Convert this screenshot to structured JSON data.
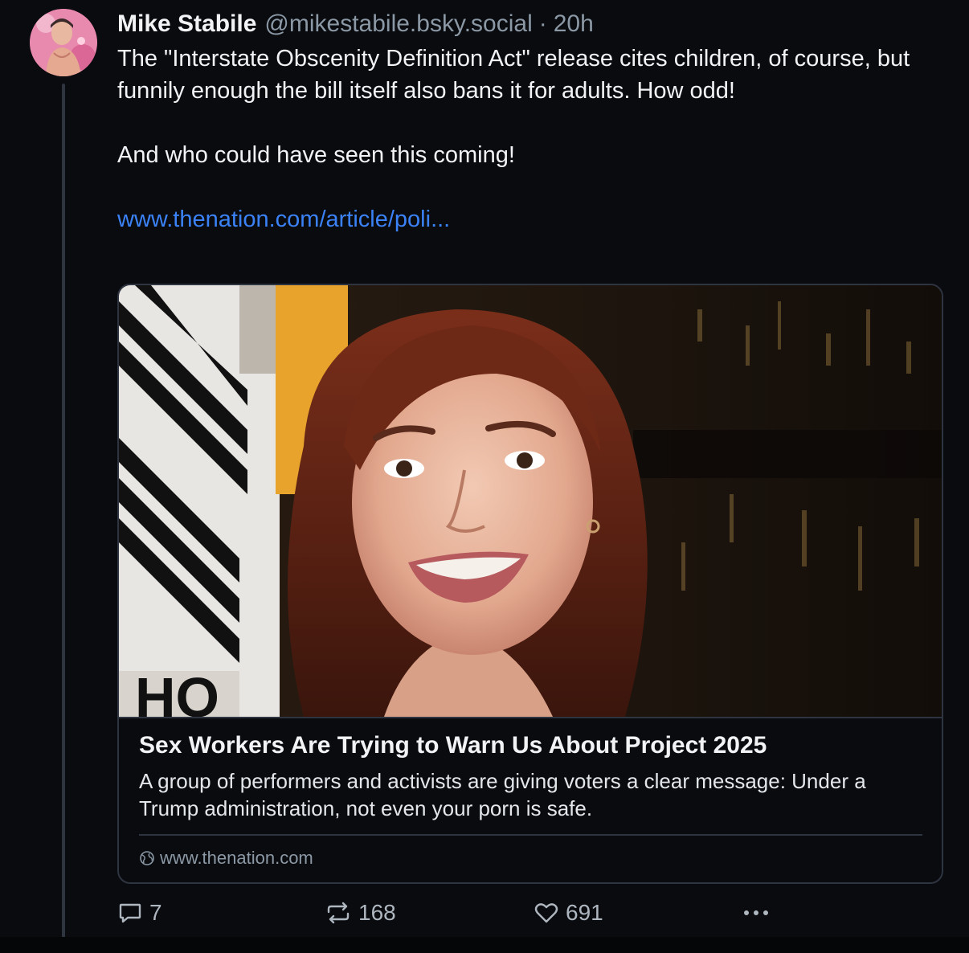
{
  "post": {
    "author": {
      "display_name": "Mike Stabile",
      "handle": "@mikestabile.bsky.social",
      "separator": "·",
      "time": "20h"
    },
    "text": {
      "paragraph1": "The \"Interstate Obscenity Definition Act\" release cites children, of course, but funnily enough the bill itself also bans it for adults. How odd!",
      "paragraph2": "And who could have seen this coming!",
      "link_text": "www.thenation.com/article/poli..."
    },
    "link_card": {
      "title": "Sex Workers Are Trying to Warn Us About Project 2025",
      "description": "A group of performers and activists are giving voters a clear message: Under a Trump administration, not even your porn is safe.",
      "domain": "www.thenation.com",
      "domain_icon": "globe-icon"
    },
    "actions": {
      "reply_count": "7",
      "repost_count": "168",
      "like_count": "691",
      "reply_icon": "reply-icon",
      "repost_icon": "repost-icon",
      "like_icon": "heart-icon",
      "more_icon": "more-icon"
    }
  },
  "colors": {
    "background": "#0a0b0f",
    "text": "#f1f3f5",
    "muted": "#8b98a5",
    "link": "#3b82f6",
    "border": "#2e3440"
  }
}
